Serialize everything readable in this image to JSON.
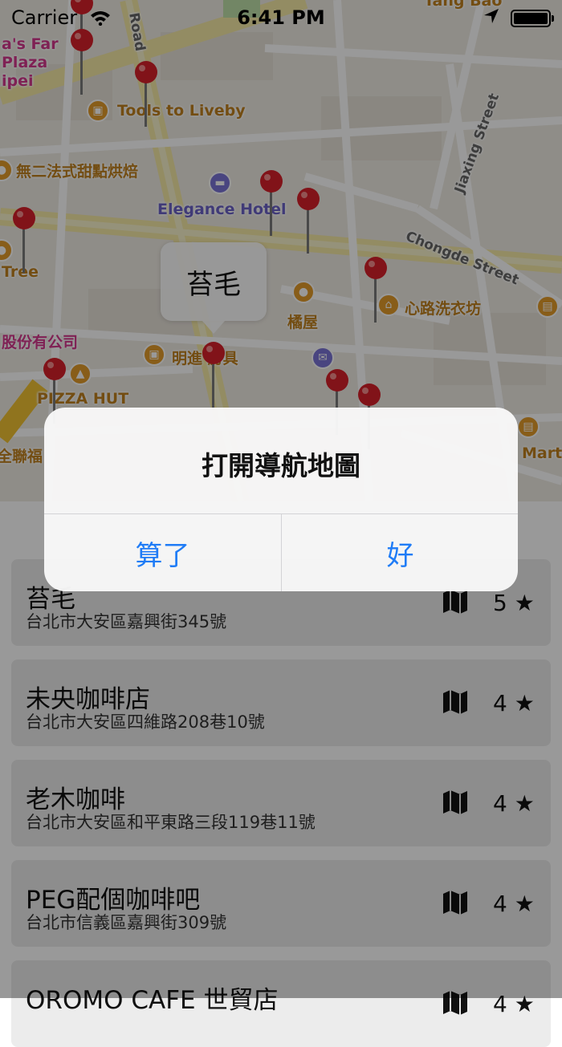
{
  "status_bar": {
    "carrier": "Carrier",
    "time": "6:41 PM"
  },
  "map": {
    "labels": {
      "farplaza_1": "a's Far",
      "farplaza_2": "Plaza",
      "farplaza_3": "ipei",
      "road": "Road",
      "tangbao": "Tang Bao",
      "tools": "Tools to Liveby",
      "dessert": "無二法式甜點烘焙",
      "hotel": "Elegance Hotel",
      "jiaxing": "Jiaxing Street",
      "chongde": "Chongde Street",
      "tree": "Tree",
      "laundry": "心路洗衣坊",
      "kitchen": "橘屋",
      "company": "股份有公司",
      "furniture": "明進   房具",
      "pizzahut": "PIZZA HUT",
      "lianfu": "全聯福",
      "mart": "Mart"
    },
    "callout": "苔毛"
  },
  "alert": {
    "title": "打開導航地圖",
    "cancel_label": "算了",
    "ok_label": "好"
  },
  "places": [
    {
      "name": "苔毛",
      "address": "台北市大安區嘉興街345號",
      "rating": "5 ★"
    },
    {
      "name": "未央咖啡店",
      "address": "台北市大安區四維路208巷10號",
      "rating": "4 ★"
    },
    {
      "name": "老木咖啡",
      "address": "台北市大安區和平東路三段119巷11號",
      "rating": "4 ★"
    },
    {
      "name": "PEG配個咖啡吧",
      "address": "台北市信義區嘉興街309號",
      "rating": "4 ★"
    },
    {
      "name": "OROMO CAFE 世貿店",
      "address": "",
      "rating": "4 ★"
    }
  ],
  "colors": {
    "accent": "#1f7cf6",
    "pin": "#d8212b",
    "poi_orange": "#e39c2a"
  }
}
